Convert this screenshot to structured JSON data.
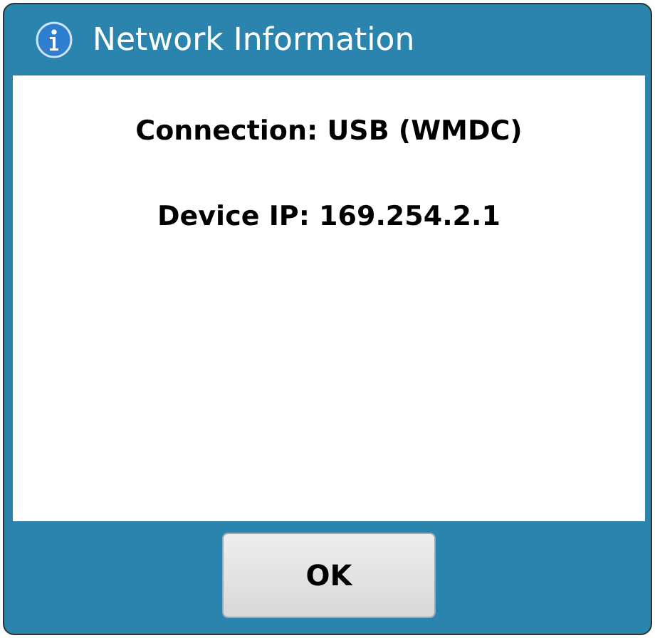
{
  "window": {
    "title": "Network Information"
  },
  "lines": [
    "Connection: USB (WMDC)",
    "Device IP: 169.254.2.1"
  ],
  "buttons": [
    "OK"
  ]
}
